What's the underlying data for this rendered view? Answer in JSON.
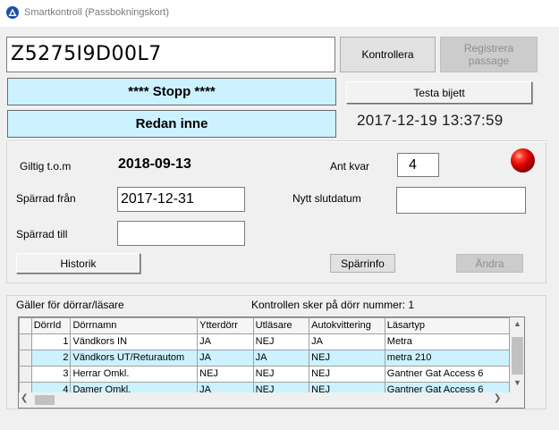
{
  "window": {
    "title": "Smartkontroll  (Passbokningskort)",
    "icon": "triangle-logo-icon"
  },
  "ticket": {
    "number": "Z5275I9D00L7"
  },
  "buttons": {
    "kontrollera": "Kontrollera",
    "registrera": "Registrera\npassage",
    "testa": "Testa bijett",
    "historik": "Historik",
    "sparrinfo": "Spärrinfo",
    "andra": "Ändra"
  },
  "status": {
    "line1": "**** Stopp ****",
    "line2": "Redan inne",
    "box_color": "#ccf2ff",
    "indicator_color": "#d40000"
  },
  "datetime": "2017-12-19 13:37:59",
  "validity": {
    "giltig_label": "Giltig t.o.m",
    "giltig_value": "2018-09-13",
    "ant_kvar_label": "Ant kvar",
    "ant_kvar_value": "4",
    "sparrad_fran_label": "Spärrad från",
    "sparrad_fran_value": "2017-12-31",
    "nytt_slutdatum_label": "Nytt slutdatum",
    "nytt_slutdatum_value": "",
    "sparrad_till_label": "Spärrad till",
    "sparrad_till_value": ""
  },
  "doors": {
    "group_label": "Gäller för dörrar/läsare",
    "control_label": "Kontrollen sker på dörr nummer: 1",
    "columns": [
      "DörrId",
      "Dörrnamn",
      "Ytterdörr",
      "Utläsare",
      "Autokvittering",
      "Läsartyp"
    ],
    "rows": [
      [
        "1",
        "Vändkors IN",
        "JA",
        "NEJ",
        "JA",
        "Metra"
      ],
      [
        "2",
        "Vändkors UT/Returautom",
        "JA",
        "JA",
        "NEJ",
        "metra 210"
      ],
      [
        "3",
        "Herrar Omkl.",
        "NEJ",
        "NEJ",
        "NEJ",
        "Gantner Gat Access 6"
      ],
      [
        "4",
        "Damer Omkl.",
        "JA",
        "NEJ",
        "NEJ",
        "Gantner Gat Access 6"
      ]
    ]
  }
}
